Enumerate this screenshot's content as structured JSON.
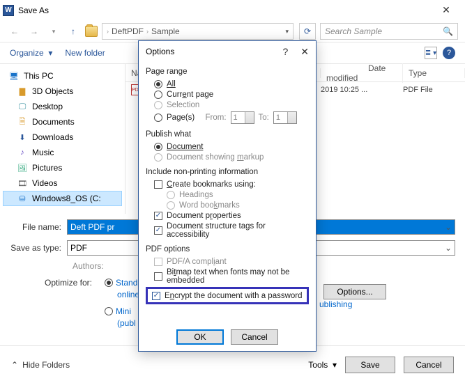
{
  "title": "Save As",
  "nav": {
    "pathA": "DeftPDF",
    "pathB": "Sample",
    "search_placeholder": "Search Sample"
  },
  "toolbar": {
    "organize": "Organize",
    "newfolder": "New folder"
  },
  "columns": {
    "name": "Name",
    "date": "Date modified",
    "type": "Type"
  },
  "tree": {
    "thispc": "This PC",
    "objects": "3D Objects",
    "desktop": "Desktop",
    "documents": "Documents",
    "downloads": "Downloads",
    "music": "Music",
    "pictures": "Pictures",
    "videos": "Videos",
    "drive": "Windows8_OS (C:"
  },
  "file": {
    "date": "2019 10:25 ...",
    "type": "PDF File"
  },
  "form": {
    "filename_label": "File name:",
    "filename_value": "Deft PDF pr",
    "saveas_label": "Save as type:",
    "saveas_value": "PDF",
    "authors_label": "Authors:",
    "optimize_label": "Optimize for:",
    "opt_standard": "Standard (publishing online and printing)",
    "opt_std_a": "Stand",
    "opt_std_b": "online",
    "opt_minimum": "Minimum size (publishing online)",
    "opt_min_a": "Mini",
    "opt_min_b": "(publ",
    "opt_min_tail": "ublishing",
    "options_btn": "Options..."
  },
  "footer": {
    "hide": "Hide Folders",
    "tools": "Tools",
    "save": "Save",
    "cancel": "Cancel"
  },
  "dlg": {
    "title": "Options",
    "page_range": "Page range",
    "all": "All",
    "current": "Current page",
    "selection": "Selection",
    "pages": "Page(s)",
    "from": "From:",
    "to": "To:",
    "from_v": "1",
    "to_v": "1",
    "publish": "Publish what",
    "document": "Document",
    "markup": "Document showing markup",
    "nonprint": "Include non-printing information",
    "bookmarks": "Create bookmarks using:",
    "headings": "Headings",
    "wordbm": "Word bookmarks",
    "docprops": "Document properties",
    "structtags": "Document structure tags for accessibility",
    "pdfopt": "PDF options",
    "pdfa": "PDF/A compliant",
    "bitmap": "Bitmap text when fonts may not be embedded",
    "encrypt": "Encrypt the document with a password",
    "ok": "OK",
    "cancel": "Cancel"
  }
}
